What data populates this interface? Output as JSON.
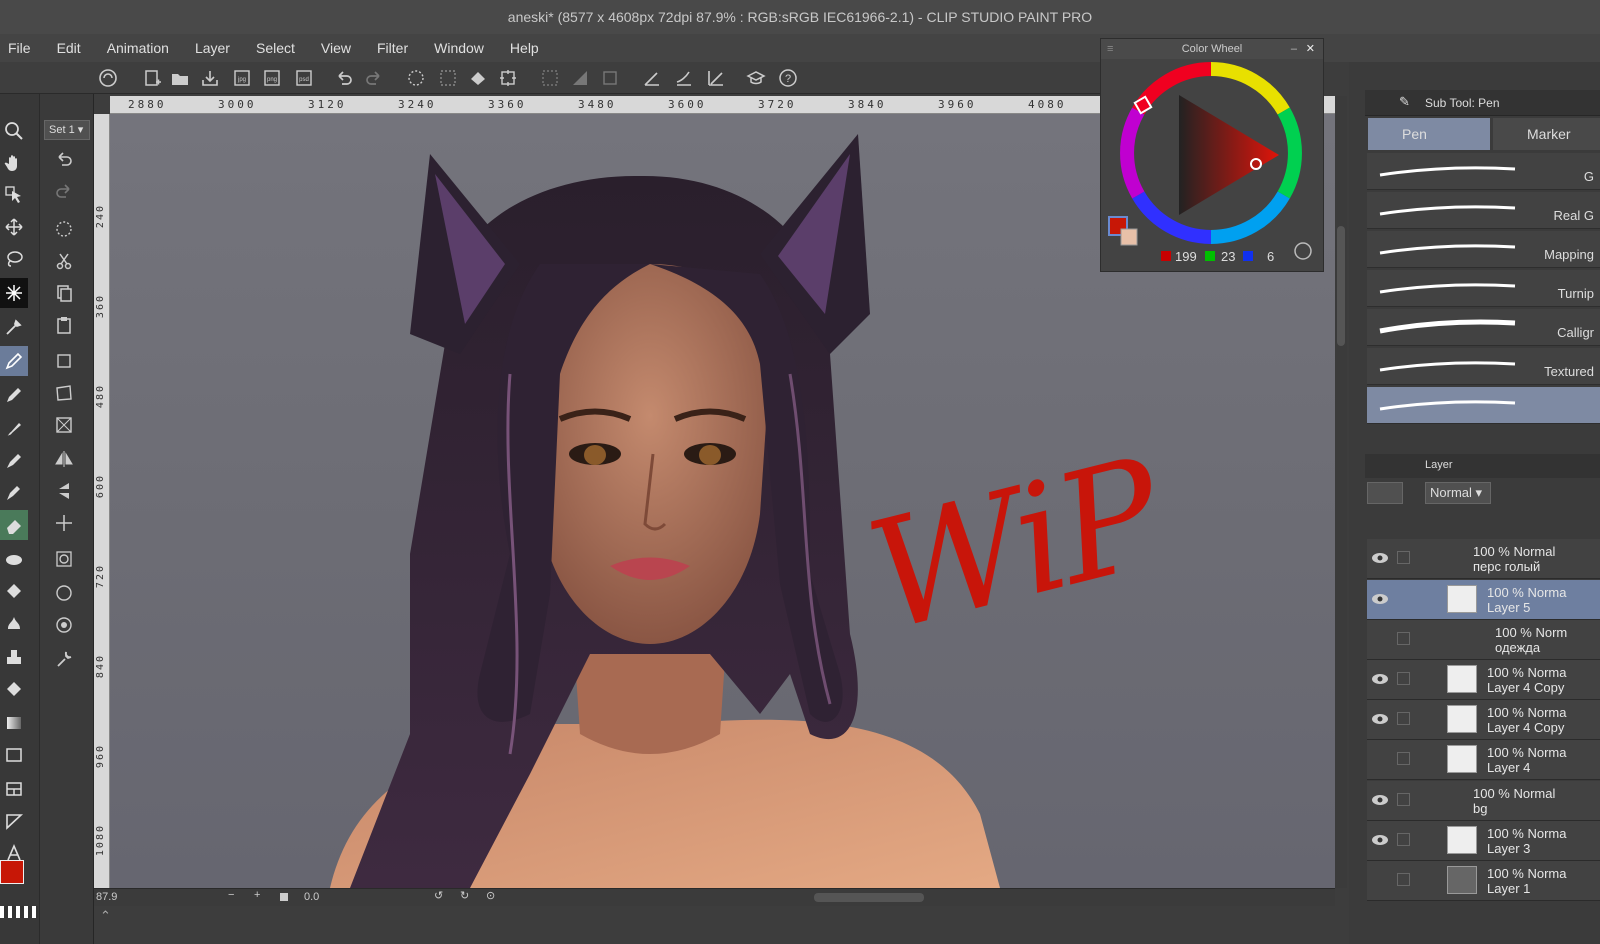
{
  "window": {
    "title": "aneski* (8577 x 4608px 72dpi 87.9% : RGB:sRGB IEC61966-2.1)  - CLIP STUDIO PAINT PRO"
  },
  "menu": [
    "File",
    "Edit",
    "Animation",
    "Layer",
    "Select",
    "View",
    "Filter",
    "Window",
    "Help"
  ],
  "subtool_set": "Set 1",
  "ruler": {
    "top": [
      "2880",
      "3000",
      "3120",
      "3240",
      "3360",
      "3480",
      "3600",
      "3720",
      "3840",
      "3960",
      "4080"
    ],
    "left": [
      "240",
      "360",
      "480",
      "600",
      "720",
      "840",
      "960",
      "1080"
    ]
  },
  "canvas": {
    "annotation": "WiP"
  },
  "status": {
    "zoom": "87.9",
    "rotation": "0.0"
  },
  "color_wheel": {
    "title": "Color Wheel",
    "r": "199",
    "g": "23",
    "b": "6",
    "main_color": "#c71706",
    "sub_color": "#e8c0a8"
  },
  "sub_tool": {
    "panel_title": "Sub Tool: Pen",
    "tabs": [
      "Pen",
      "Marker"
    ],
    "brushes": [
      "G",
      "Real G",
      "Mapping",
      "Turnip",
      "Calligr",
      "Textured",
      ""
    ]
  },
  "layer_panel": {
    "title": "Layer",
    "blend_mode": "Normal",
    "layers": [
      {
        "mode": "100 % Normal",
        "name": "перс голый"
      },
      {
        "mode": "100 % Norma",
        "name": "Layer 5"
      },
      {
        "mode": "100 % Norm",
        "name": "одежда"
      },
      {
        "mode": "100 % Norma",
        "name": "Layer 4 Copy"
      },
      {
        "mode": "100 % Norma",
        "name": "Layer 4 Copy"
      },
      {
        "mode": "100 % Norma",
        "name": "Layer 4"
      },
      {
        "mode": "100 % Normal",
        "name": "bg"
      },
      {
        "mode": "100 % Norma",
        "name": "Layer 3"
      },
      {
        "mode": "100 % Norma",
        "name": "Layer 1"
      }
    ]
  }
}
